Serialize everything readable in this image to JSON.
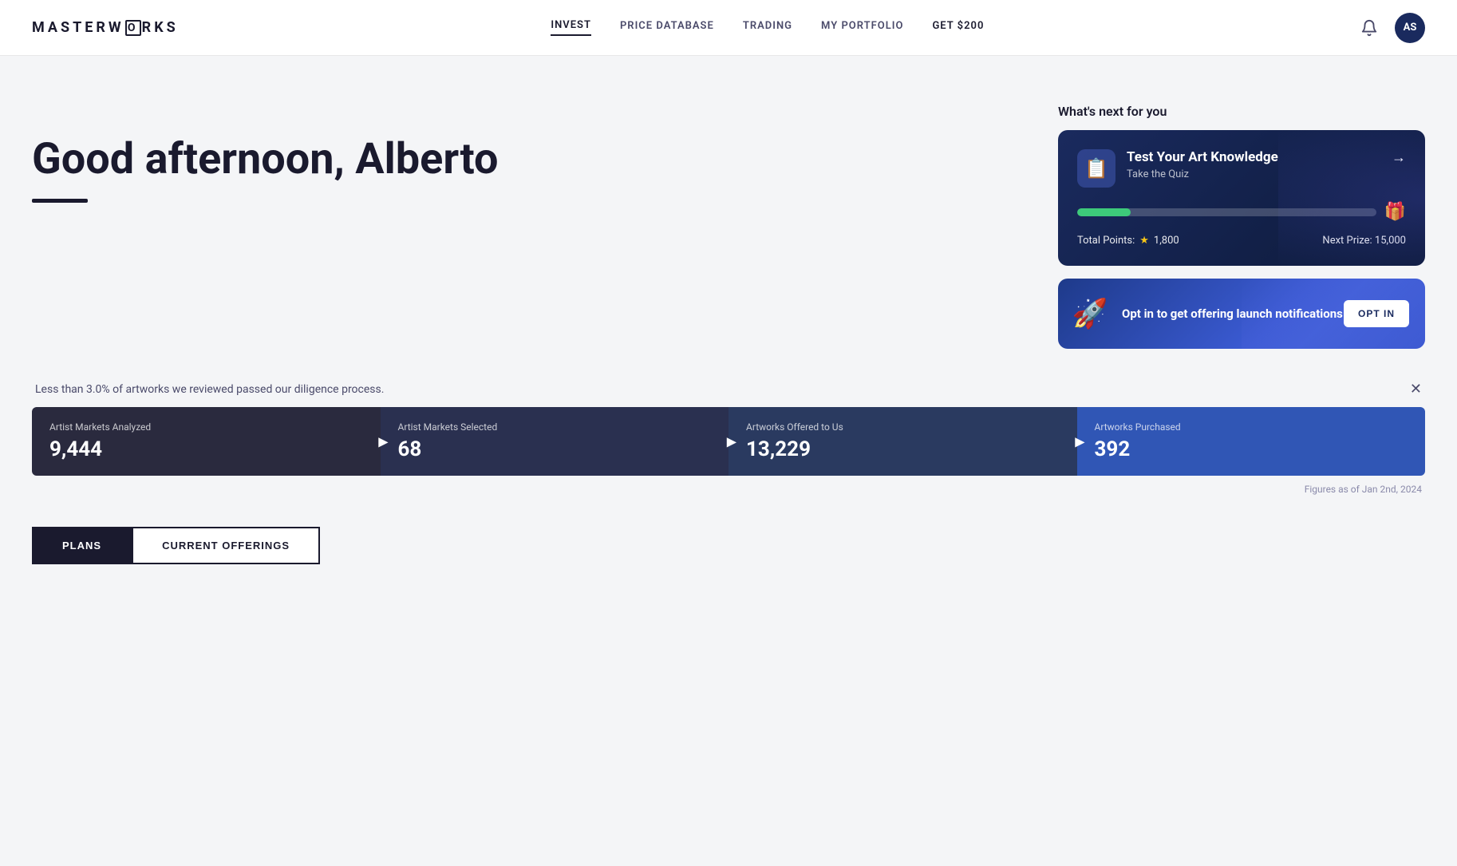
{
  "header": {
    "logo_text": "MASTERW",
    "logo_letter": "O",
    "logo_rest": "RKS",
    "nav": [
      {
        "id": "invest",
        "label": "INVEST",
        "active": true
      },
      {
        "id": "price-database",
        "label": "PRICE DATABASE",
        "active": false
      },
      {
        "id": "trading",
        "label": "TRADING",
        "active": false
      },
      {
        "id": "my-portfolio",
        "label": "MY PORTFOLIO",
        "active": false
      },
      {
        "id": "get200",
        "label": "GET $200",
        "active": false
      }
    ],
    "avatar_initials": "AS"
  },
  "greeting": {
    "text": "Good afternoon, Alberto"
  },
  "whats_next": {
    "label": "What's next for you",
    "quiz_card": {
      "title": "Test Your Art Knowledge",
      "subtitle": "Take the Quiz",
      "total_points_label": "Total Points:",
      "total_points_value": "1,800",
      "next_prize_label": "Next Prize: 15,000",
      "progress_percent": 18
    },
    "optin_card": {
      "text": "Opt in to get offering launch\nnotifications",
      "button_label": "OPT IN"
    }
  },
  "diligence": {
    "text": "Less than 3.0% of artworks we reviewed passed our diligence process."
  },
  "stats": [
    {
      "label": "Artist Markets Analyzed",
      "value": "9,444"
    },
    {
      "label": "Artist Markets Selected",
      "value": "68"
    },
    {
      "label": "Artworks Offered to Us",
      "value": "13,229"
    },
    {
      "label": "Artworks Purchased",
      "value": "392"
    }
  ],
  "figures_note": "Figures as of Jan 2nd, 2024",
  "tabs": [
    {
      "id": "plans",
      "label": "PLANS",
      "active": true
    },
    {
      "id": "current-offerings",
      "label": "CURRENT OFFERINGS",
      "active": false
    }
  ]
}
